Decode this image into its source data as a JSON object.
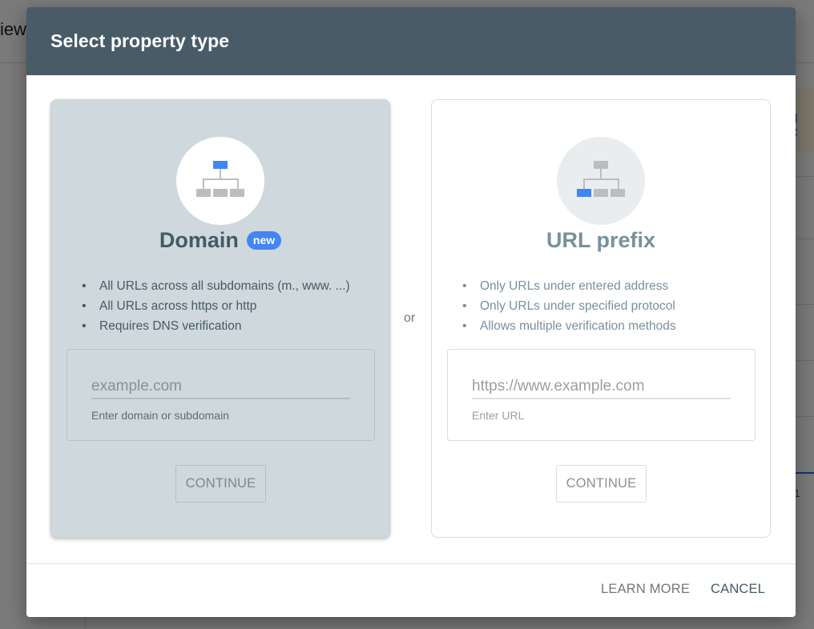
{
  "background": {
    "header_fragment": "iew",
    "right_banner_fragment": "H C",
    "right_number_fragment": "1"
  },
  "dialog": {
    "title": "Select property type",
    "separator": "or",
    "domain_card": {
      "title": "Domain",
      "badge": "new",
      "icon": "sitemap-icon",
      "features": [
        "All URLs across all subdomains (m., www. ...)",
        "All URLs across https or http",
        "Requires DNS verification"
      ],
      "input_placeholder": "example.com",
      "input_value": "",
      "helper_text": "Enter domain or subdomain",
      "continue_label": "CONTINUE"
    },
    "url_card": {
      "title": "URL prefix",
      "icon": "sitemap-icon",
      "features": [
        "Only URLs under entered address",
        "Only URLs under specified protocol",
        "Allows multiple verification methods"
      ],
      "input_placeholder": "https://www.example.com",
      "input_value": "",
      "helper_text": "Enter URL",
      "continue_label": "CONTINUE"
    },
    "footer": {
      "learn_more_label": "LEARN MORE",
      "cancel_label": "CANCEL"
    }
  },
  "colors": {
    "header_bg": "#485b67",
    "accent_blue": "#4285f4",
    "domain_card_bg": "#cfd8dd",
    "node_gray": "#bdbdbd"
  }
}
